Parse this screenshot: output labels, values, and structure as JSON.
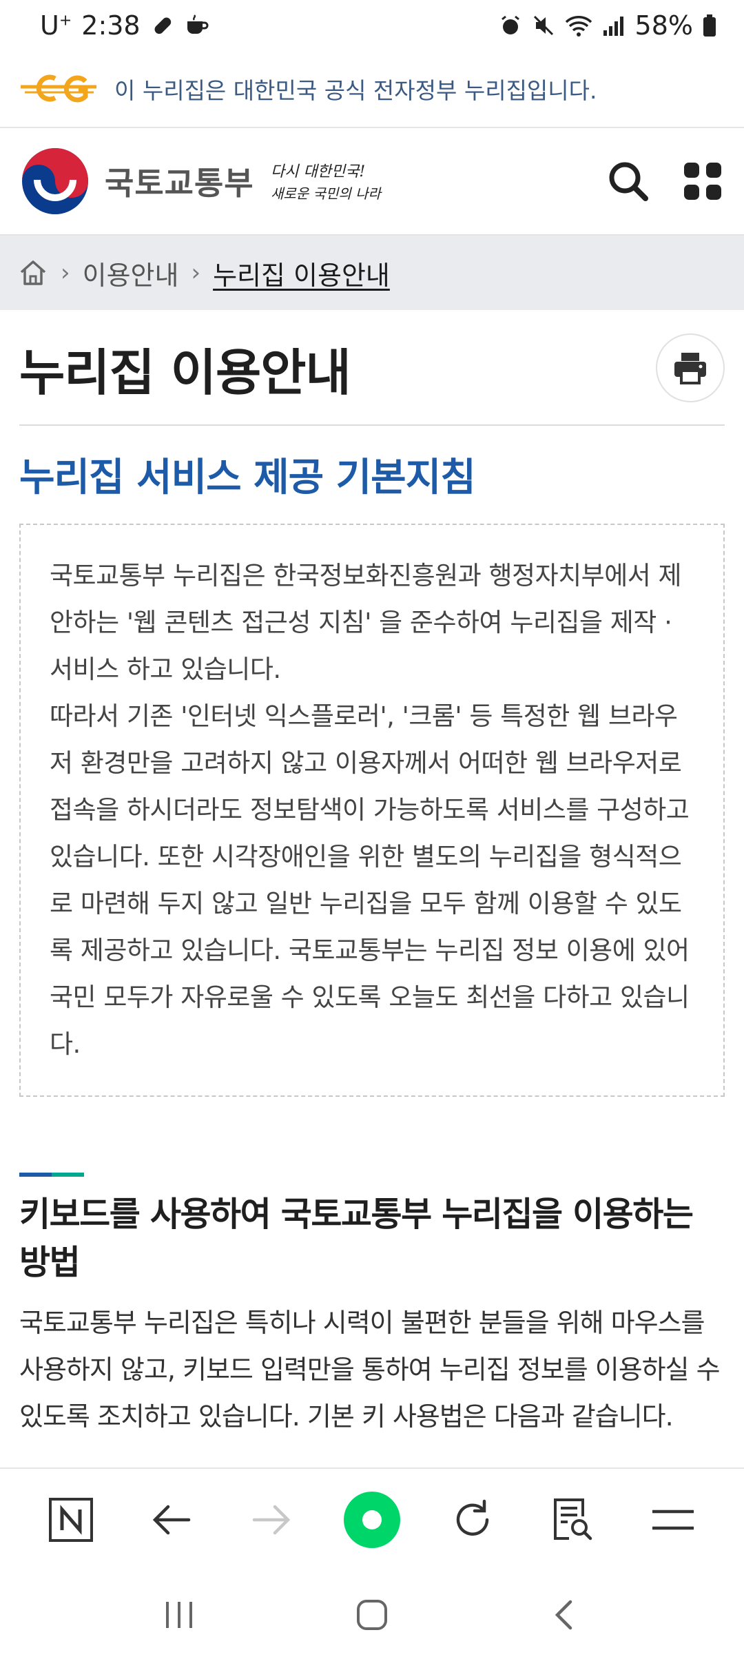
{
  "status_bar": {
    "carrier": "U",
    "carrier_sup": "+",
    "time": "2:38",
    "battery": "58%"
  },
  "gov_banner": {
    "text": "이 누리집은 대한민국 공식 전자정부 누리집입니다."
  },
  "header": {
    "ministry_name": "국토교통부",
    "slogan_line1": "다시 대한민국!",
    "slogan_line2": "새로운 국민의 나라",
    "search_icon": "search-icon",
    "menu_icon": "grid-menu-icon"
  },
  "breadcrumb": {
    "home_icon": "home-icon",
    "items": [
      "이용안내",
      "누리집 이용안내"
    ]
  },
  "page": {
    "title": "누리집 이용안내",
    "print_icon": "printer-icon",
    "section_title": "누리집 서비스 제공 기본지침",
    "notice_paragraph_1": "국토교통부 누리집은 한국정보화진흥원과 행정자치부에서 제안하는 '웹 콘텐츠 접근성 지침' 을 준수하여 누리집을 제작 · 서비스 하고 있습니다.",
    "notice_paragraph_2": "따라서 기존 '인터넷 익스플로러', '크롬' 등 특정한 웹 브라우저 환경만을 고려하지 않고 이용자께서 어떠한 웹 브라우저로 접속을 하시더라도 정보탐색이 가능하도록 서비스를 구성하고 있습니다. 또한 시각장애인을 위한 별도의 누리집을 형식적으로 마련해 두지 않고 일반 누리집을 모두 함께 이용할 수 있도록 제공하고 있습니다. 국토교통부는 누리집 정보 이용에 있어 국민 모두가 자유로울 수 있도록 오늘도 최선을 다하고 있습니다.",
    "keyboard_heading": "키보드를 사용하여 국토교통부 누리집을 이용하는 방법",
    "keyboard_text": "국토교통부 누리집은 특히나 시력이 불편한 분들을 위해 마우스를 사용하지 않고, 키보드 입력만을 통하여 누리집 정보를 이용하실 수 있도록 조치하고 있습니다. 기본 키 사용법은 다음과 같습니다."
  },
  "browser_bar": {
    "items": [
      "naver-home-icon",
      "back-arrow-icon",
      "forward-arrow-icon",
      "green-dot-icon",
      "refresh-icon",
      "page-search-icon",
      "hamburger-menu-icon"
    ]
  },
  "nav_bar": {
    "items": [
      "recent-apps-icon",
      "home-circle-icon",
      "back-chevron-icon"
    ]
  },
  "colors": {
    "accent_blue": "#1d5aa7",
    "accent_green": "#00c98a",
    "banner_text": "#3b5a83"
  }
}
